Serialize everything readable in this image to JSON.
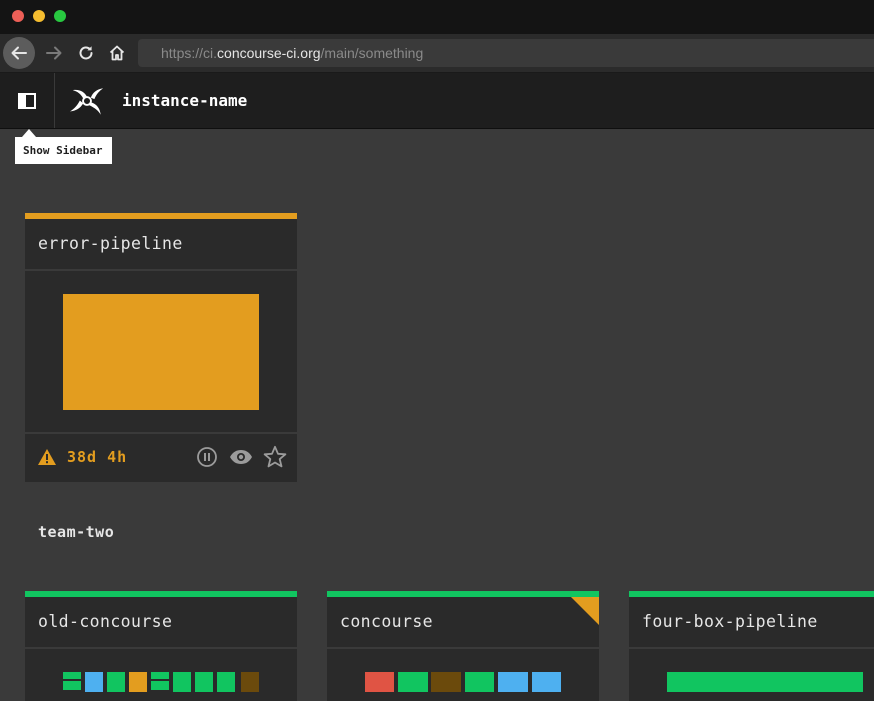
{
  "browser": {
    "url_prefix": "https://ci.",
    "url_host": "concourse-ci.org",
    "url_path": "/main/something"
  },
  "topbar": {
    "instance_name": "instance-name",
    "sidebar_tooltip": "Show Sidebar"
  },
  "pipelines": [
    {
      "name": "error-pipeline",
      "status_color": "#e39d1f",
      "status_text": "38d 4h",
      "icons": [
        "pause-icon",
        "eye-icon",
        "star-icon"
      ]
    }
  ],
  "team_two": {
    "name": "team-two",
    "pipelines": [
      {
        "name": "old-concourse",
        "status_color": "#11c560"
      },
      {
        "name": "concourse",
        "status_color": "#11c560",
        "corner_color": "#e39d1f"
      },
      {
        "name": "four-box-pipeline",
        "status_color": "#11c560"
      }
    ]
  },
  "colors": {
    "succeeded": "#11c560",
    "errored": "#e39d1f",
    "failed": "#e05444",
    "running": "#4eb0f0",
    "paused": "#6b4a0c"
  }
}
